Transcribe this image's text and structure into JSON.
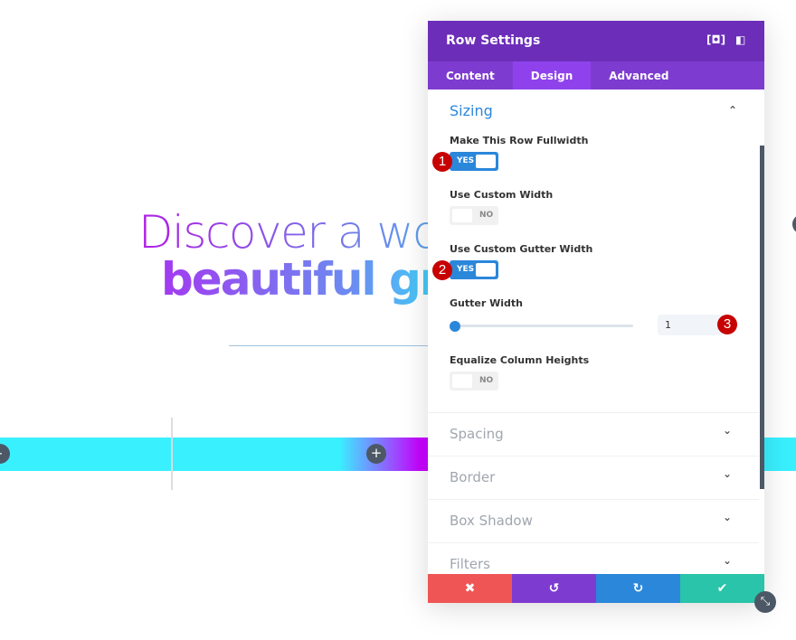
{
  "background": {
    "heading_line1": "Discover a wo",
    "heading_line2": "beautiful gr",
    "add_icon": "+",
    "remove_icon": "-"
  },
  "panel": {
    "title": "Row Settings",
    "header_icons": [
      "focus-icon",
      "split-view-icon"
    ],
    "tabs": [
      {
        "label": "Content"
      },
      {
        "label": "Design",
        "active": true
      },
      {
        "label": "Advanced"
      }
    ],
    "sizing": {
      "title": "Sizing",
      "fields": [
        {
          "label": "Make This Row Fullwidth",
          "value": "YES",
          "badge": "1"
        },
        {
          "label": "Use Custom Width",
          "value": "NO"
        },
        {
          "label": "Use Custom Gutter Width",
          "value": "YES",
          "badge": "2"
        },
        {
          "label": "Gutter Width",
          "value": "1",
          "badge": "3"
        },
        {
          "label": "Equalize Column Heights",
          "value": "NO"
        }
      ]
    },
    "sections": [
      {
        "label": "Spacing"
      },
      {
        "label": "Border"
      },
      {
        "label": "Box Shadow"
      },
      {
        "label": "Filters"
      }
    ],
    "footer": {
      "cancel": "✖",
      "undo": "↺",
      "redo": "↻",
      "save": "✔"
    },
    "colors": {
      "header": "#6c2eb9",
      "tabs": "#7e3bd0",
      "accent": "#2b87da",
      "cancel": "#ef5555",
      "undo": "#7e3bd0",
      "redo": "#2b87da",
      "save": "#29c4a9"
    }
  }
}
